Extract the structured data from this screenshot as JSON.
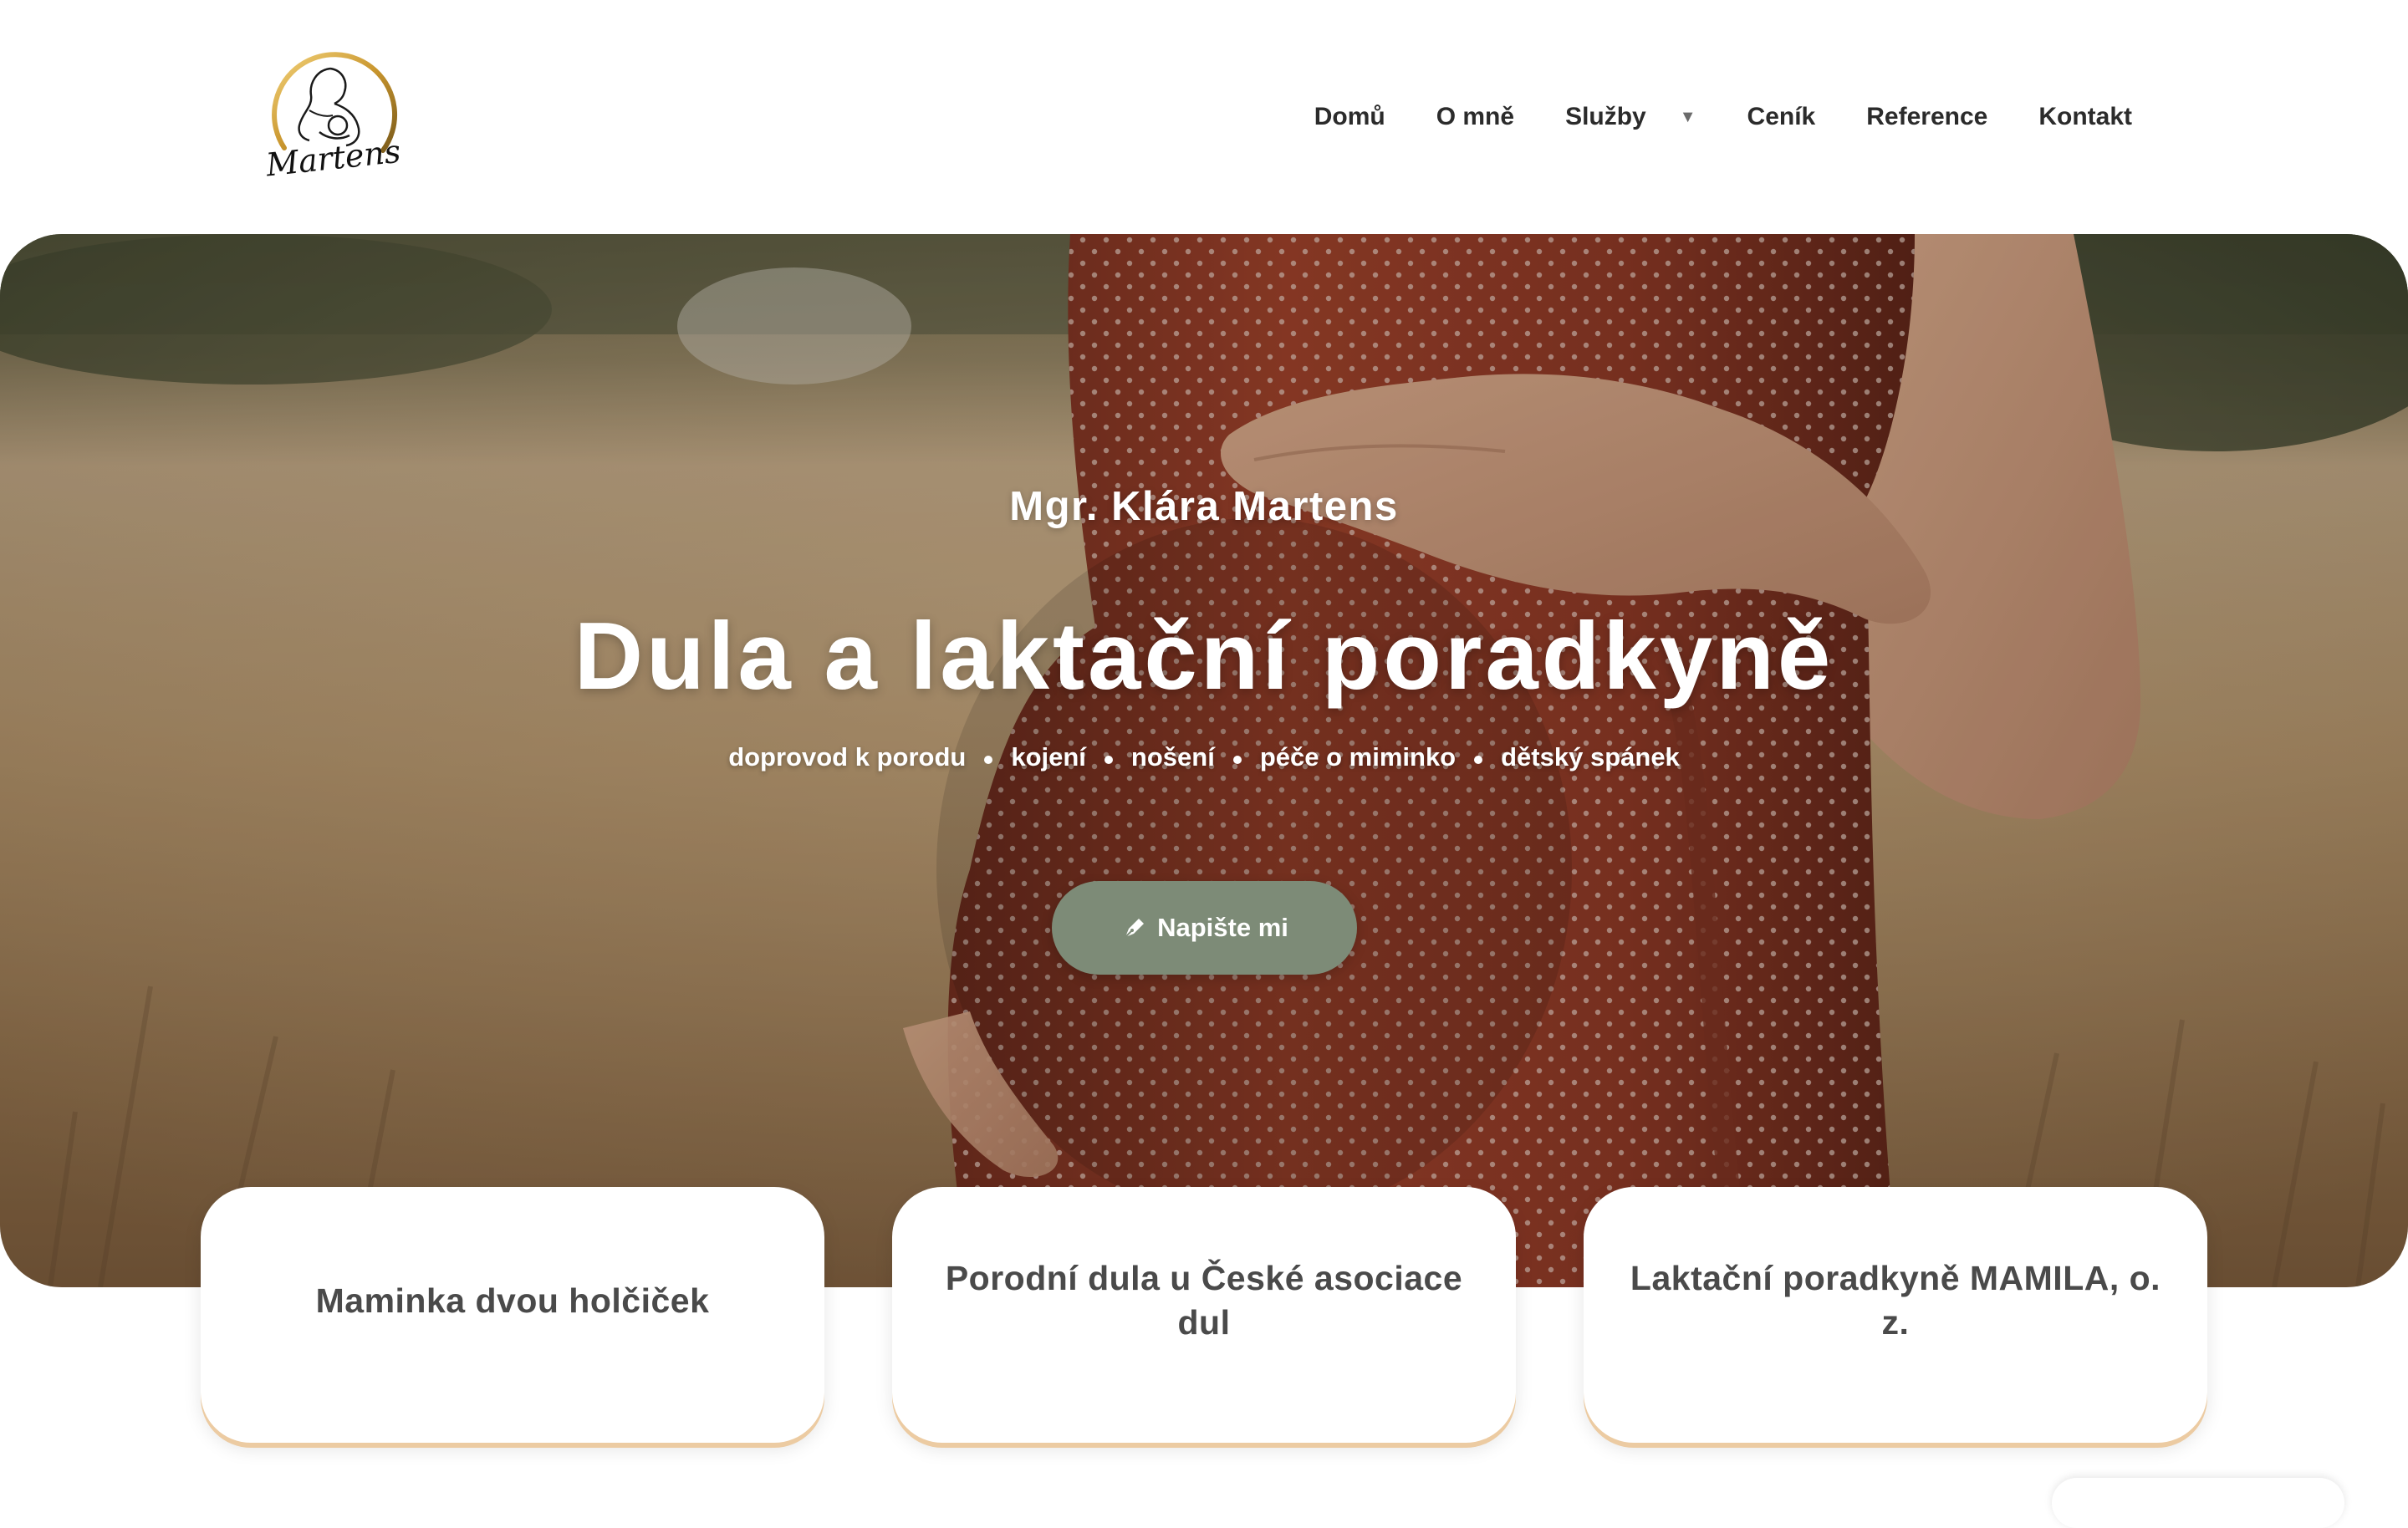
{
  "header": {
    "logo_text": "Martens",
    "nav": [
      {
        "label": "Domů"
      },
      {
        "label": "O mně"
      },
      {
        "label": "Služby",
        "has_dropdown": true
      },
      {
        "label": "Ceník"
      },
      {
        "label": "Reference"
      },
      {
        "label": "Kontakt"
      }
    ]
  },
  "hero": {
    "subtitle": "Mgr. Klára Martens",
    "title": "Dula a laktační poradkyně",
    "tags": [
      "doprovod k porodu",
      "kojení",
      "nošení",
      "péče o miminko",
      "dětský spánek"
    ],
    "cta_label": "Napište mi",
    "cta_icon": "pen-nib-icon",
    "cta_color": "#7d8b77"
  },
  "cards": [
    {
      "text": "Maminka dvou holčiček"
    },
    {
      "text": "Porodní dula u České asociace dul"
    },
    {
      "text": "Laktační poradkyně MAMILA, o. z."
    }
  ],
  "colors": {
    "accent_underline": "#eccba2",
    "text_dark": "#2b2b2b"
  }
}
